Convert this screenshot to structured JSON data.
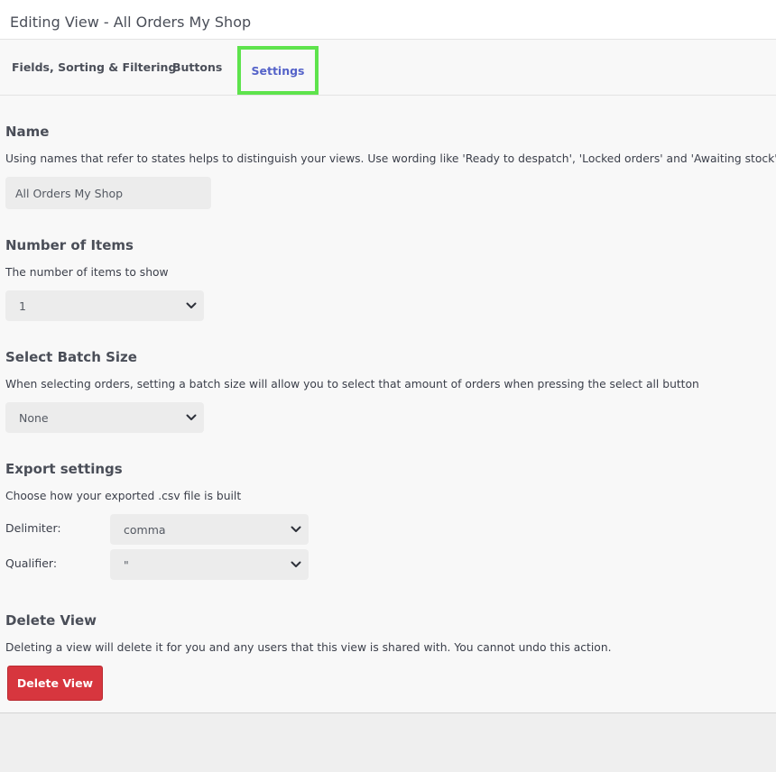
{
  "window": {
    "title": "Editing View - All Orders My Shop"
  },
  "tabs": [
    {
      "label": "Fields, Sorting & Filtering",
      "active": false
    },
    {
      "label": "Buttons",
      "active": false
    },
    {
      "label": "Settings",
      "active": true
    }
  ],
  "name_section": {
    "heading": "Name",
    "description": "Using names that refer to states helps to distinguish your views. Use wording like 'Ready to despatch', 'Locked orders' and 'Awaiting stock'.",
    "value": "All Orders My Shop"
  },
  "items_section": {
    "heading": "Number of Items",
    "description": "The number of items to show",
    "selected": "1"
  },
  "batch_section": {
    "heading": "Select Batch Size",
    "description": "When selecting orders, setting a batch size will allow you to select that amount of orders when pressing the select all button",
    "selected": "None"
  },
  "export_section": {
    "heading": "Export settings",
    "description": "Choose how your exported .csv file is built",
    "delimiter_label": "Delimiter:",
    "delimiter_selected": "comma",
    "qualifier_label": "Qualifier:",
    "qualifier_selected": "\""
  },
  "delete_section": {
    "heading": "Delete View",
    "description": "Deleting a view will delete it for you and any users that this view is shared with. You cannot undo this action.",
    "button_label": "Delete View"
  },
  "colors": {
    "active_tab_text": "#5563c9",
    "highlight_border": "#5ee34c",
    "danger": "#d7363e"
  },
  "icons": {
    "dropdown": "chevron-down-icon"
  }
}
